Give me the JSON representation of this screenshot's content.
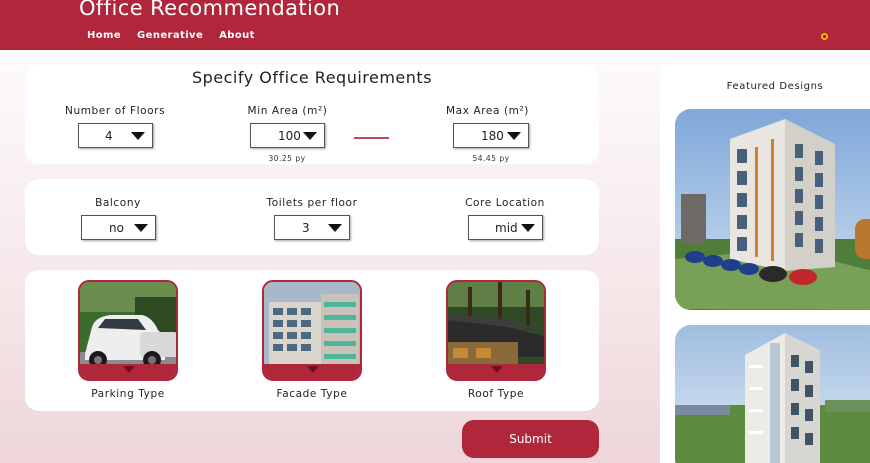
{
  "header": {
    "title": "Office Recommendation",
    "nav": [
      "Home",
      "Generative",
      "About"
    ],
    "accent_color": "#b0263a"
  },
  "requirements": {
    "title": "Specify Office Requirements",
    "floors": {
      "label": "Number of Floors",
      "value": "4"
    },
    "min_area": {
      "label": "Min Area (m²)",
      "value": "100",
      "py": "30.25 py"
    },
    "max_area": {
      "label": "Max Area (m²)",
      "value": "180",
      "py": "54.45 py"
    }
  },
  "options": {
    "balcony": {
      "label": "Balcony",
      "value": "no"
    },
    "toilets": {
      "label": "Toilets per floor",
      "value": "3"
    },
    "core": {
      "label": "Core Location",
      "value": "mid"
    }
  },
  "types": {
    "parking": "Parking Type",
    "facade": "Facade Type",
    "roof": "Roof Type"
  },
  "submit_label": "Submit",
  "featured": {
    "title": "Featured Designs"
  }
}
